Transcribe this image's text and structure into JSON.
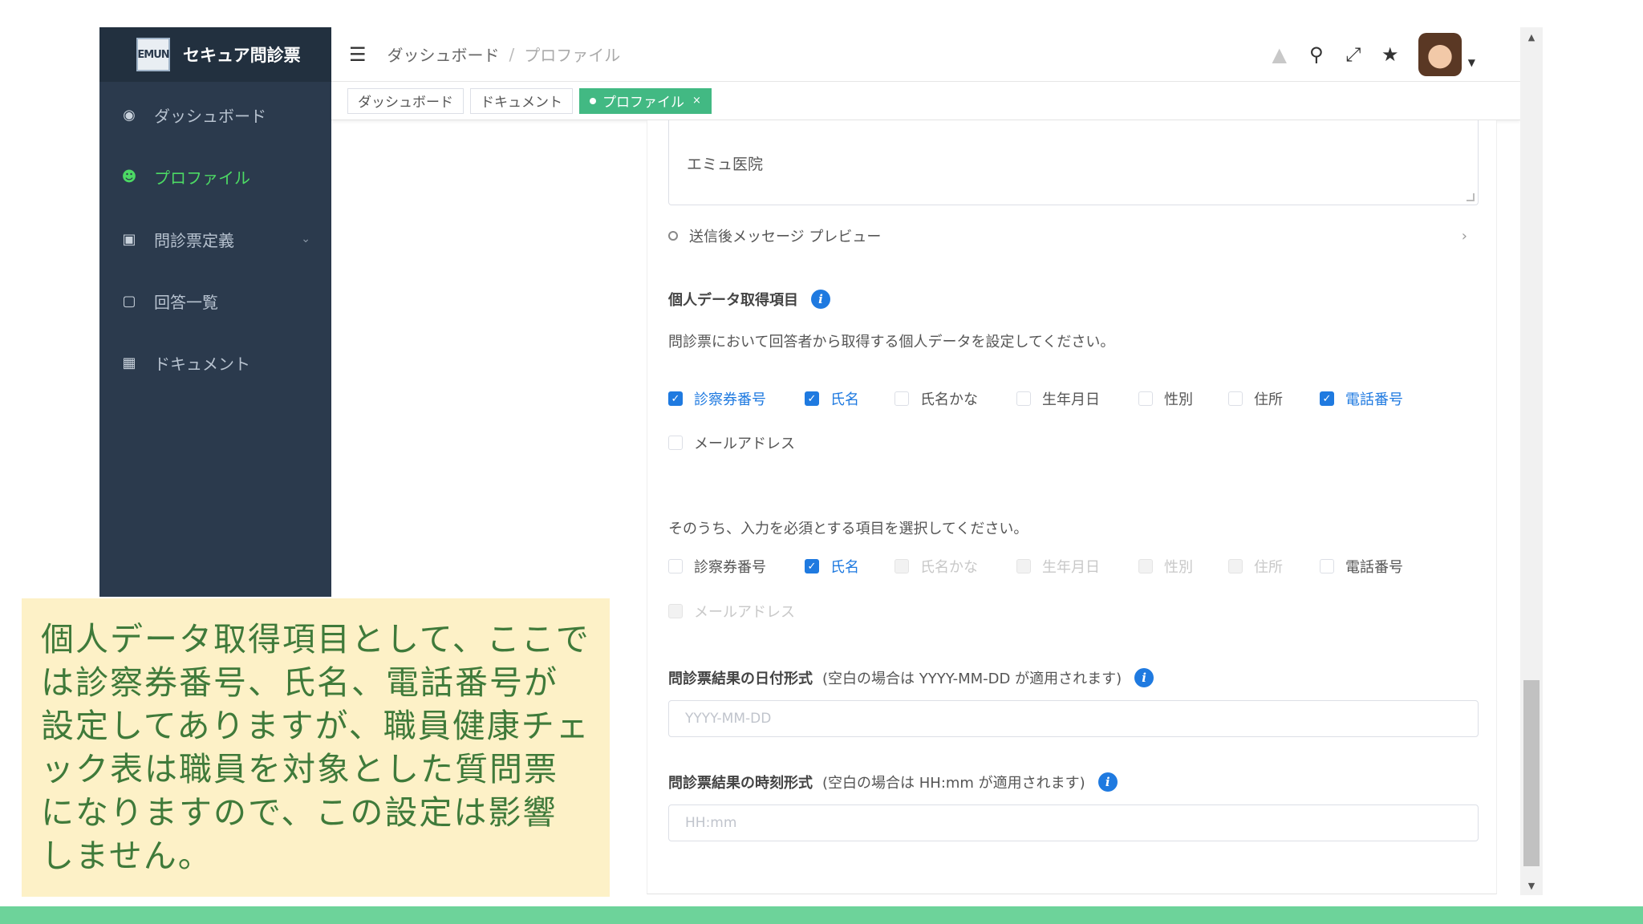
{
  "app": {
    "logo_mark": "EMUN",
    "logo_text": "セキュア問診票"
  },
  "sidebar": {
    "items": [
      {
        "label": "ダッシュボード",
        "icon": "dashboard-icon"
      },
      {
        "label": "プロファイル",
        "icon": "user-icon",
        "active": true
      },
      {
        "label": "問診票定義",
        "icon": "clipboard-icon",
        "has_submenu": true
      },
      {
        "label": "回答一覧",
        "icon": "archive-icon"
      },
      {
        "label": "ドキュメント",
        "icon": "document-icon"
      }
    ]
  },
  "header": {
    "breadcrumb": [
      "ダッシュボード",
      "プロファイル"
    ],
    "icons": [
      "lock-icon",
      "search-icon",
      "fullscreen-icon",
      "bug-icon"
    ]
  },
  "tabs": [
    {
      "label": "ダッシュボード"
    },
    {
      "label": "ドキュメント"
    },
    {
      "label": "プロファイル",
      "active": true
    }
  ],
  "form": {
    "textarea_value": "エミュ医院",
    "preview_label": "送信後メッセージ プレビュー",
    "personal_data": {
      "title": "個人データ取得項目",
      "description": "問診票において回答者から取得する個人データを設定してください。",
      "options": [
        {
          "label": "診察券番号",
          "checked": true
        },
        {
          "label": "氏名",
          "checked": true
        },
        {
          "label": "氏名かな",
          "checked": false
        },
        {
          "label": "生年月日",
          "checked": false
        },
        {
          "label": "性別",
          "checked": false
        },
        {
          "label": "住所",
          "checked": false
        },
        {
          "label": "電話番号",
          "checked": true
        },
        {
          "label": "メールアドレス",
          "checked": false
        }
      ]
    },
    "required": {
      "description": "そのうち、入力を必須とする項目を選択してください。",
      "options": [
        {
          "label": "診察券番号",
          "checked": false,
          "disabled": false
        },
        {
          "label": "氏名",
          "checked": true,
          "disabled": false
        },
        {
          "label": "氏名かな",
          "checked": false,
          "disabled": true
        },
        {
          "label": "生年月日",
          "checked": false,
          "disabled": true
        },
        {
          "label": "性別",
          "checked": false,
          "disabled": true
        },
        {
          "label": "住所",
          "checked": false,
          "disabled": true
        },
        {
          "label": "電話番号",
          "checked": false,
          "disabled": false
        },
        {
          "label": "メールアドレス",
          "checked": false,
          "disabled": true
        }
      ]
    },
    "date_format": {
      "title": "問診票結果の日付形式",
      "hint": "(空白の場合は YYYY-MM-DD が適用されます)",
      "placeholder": "YYYY-MM-DD"
    },
    "time_format": {
      "title": "問診票結果の時刻形式",
      "hint": "(空白の場合は HH:mm が適用されます)",
      "placeholder": "HH:mm"
    }
  },
  "caption": {
    "text": "個人データ取得項目として、ここでは診察券番号、氏名、電話番号が設定してありますが、職員健康チェック表は職員を対象とした質問票になりますので、この設定は影響しません。"
  },
  "colors": {
    "sidebar_bg": "#2b3a4d",
    "accent_green": "#42b983",
    "active_menu": "#4cd964",
    "checkbox_blue": "#1f7ae0",
    "callout_bg": "#fdf1c7",
    "callout_text": "#3f7a3a"
  }
}
